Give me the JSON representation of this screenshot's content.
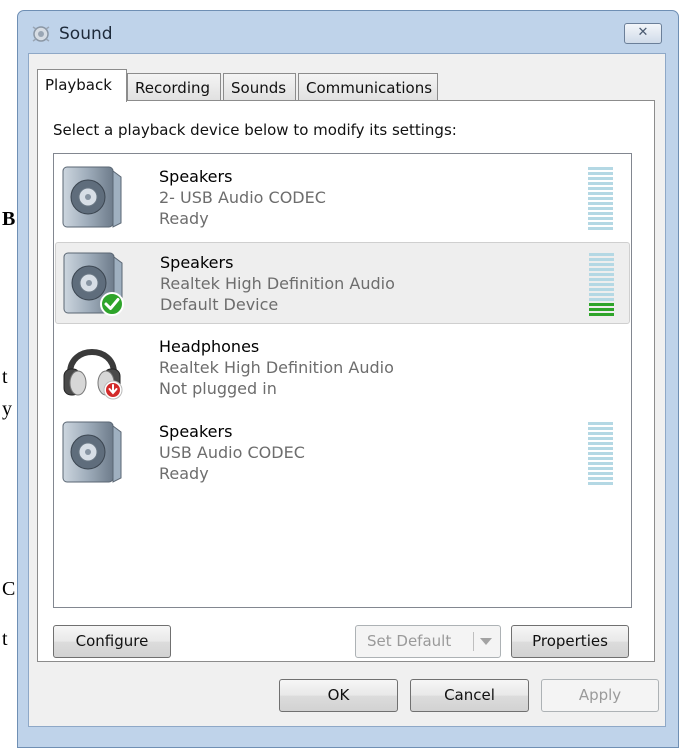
{
  "background_doc": {
    "fragments": [
      "B",
      "t",
      "y",
      "C",
      "t"
    ]
  },
  "window": {
    "title": "Sound",
    "close_glyph": "✕"
  },
  "tabs": [
    {
      "label": "Playback",
      "active": true
    },
    {
      "label": "Recording",
      "active": false
    },
    {
      "label": "Sounds",
      "active": false
    },
    {
      "label": "Communications",
      "active": false
    }
  ],
  "playback": {
    "instruction": "Select a playback device below to modify its settings:",
    "devices": [
      {
        "name": "Speakers",
        "description": "2- USB Audio CODEC",
        "status": "Ready",
        "icon": "speaker-icon",
        "selected": false,
        "level_bars_lit": 0,
        "has_meter": true
      },
      {
        "name": "Speakers",
        "description": "Realtek High Definition Audio",
        "status": "Default Device",
        "icon": "speaker-icon",
        "badge": "default-checkmark-icon",
        "selected": true,
        "level_bars_lit": 3,
        "has_meter": true
      },
      {
        "name": "Headphones",
        "description": "Realtek High Definition Audio",
        "status": "Not plugged in",
        "icon": "headphones-icon",
        "badge": "unplugged-arrow-icon",
        "selected": false,
        "has_meter": false
      },
      {
        "name": "Speakers",
        "description": "USB Audio CODEC",
        "status": "Ready",
        "icon": "speaker-icon",
        "selected": false,
        "level_bars_lit": 0,
        "has_meter": true
      }
    ],
    "buttons": {
      "configure": "Configure",
      "set_default": "Set Default",
      "properties": "Properties"
    }
  },
  "footer": {
    "ok": "OK",
    "cancel": "Cancel",
    "apply": "Apply"
  },
  "colors": {
    "window_frame": "#bfd3ea",
    "meter_off": "#b4d8e4",
    "meter_on": "#2ea42a",
    "default_badge": "#2ea42a",
    "unplugged_badge": "#d32a2a"
  }
}
